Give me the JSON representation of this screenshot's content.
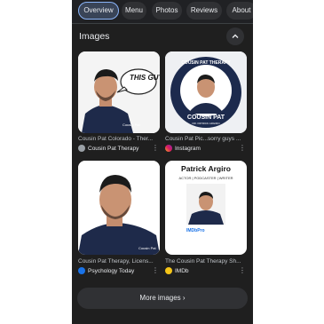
{
  "tabs": [
    {
      "label": "Overview",
      "active": true
    },
    {
      "label": "Menu",
      "active": false
    },
    {
      "label": "Photos",
      "active": false
    },
    {
      "label": "Reviews",
      "active": false
    },
    {
      "label": "About",
      "active": false
    }
  ],
  "images_section": {
    "title": "Images",
    "results": [
      {
        "caption": "Cousin Pat Colorado - Ther...",
        "source": "Cousin Pat Therapy",
        "image_text": "THIS GUY!",
        "shirt_text": "Cousin Pat"
      },
      {
        "caption": "Cousin Pat Pic...sorry guys ...",
        "source": "Instagram",
        "badge_top": "COUSIN PAT THERAPY",
        "badge_bottom": "COUSIN PAT",
        "badge_sub": "DR. PATRICK ARGIRO"
      },
      {
        "caption": "Cousin Pat Therapy, Licens...",
        "source": "Psychology Today",
        "shirt_text": "Cousin Pat"
      },
      {
        "caption": "The Cousin Pat Therapy Sh...",
        "source": "IMDb",
        "name": "Patrick Argiro",
        "roles": "ACTOR | PODCASTER | WRITER",
        "logo_text": "IMDbPro"
      }
    ],
    "more_label": "More images"
  },
  "colors": {
    "accent": "#8ab4f8",
    "bg": "#1f1f1f",
    "chip": "#303134"
  }
}
